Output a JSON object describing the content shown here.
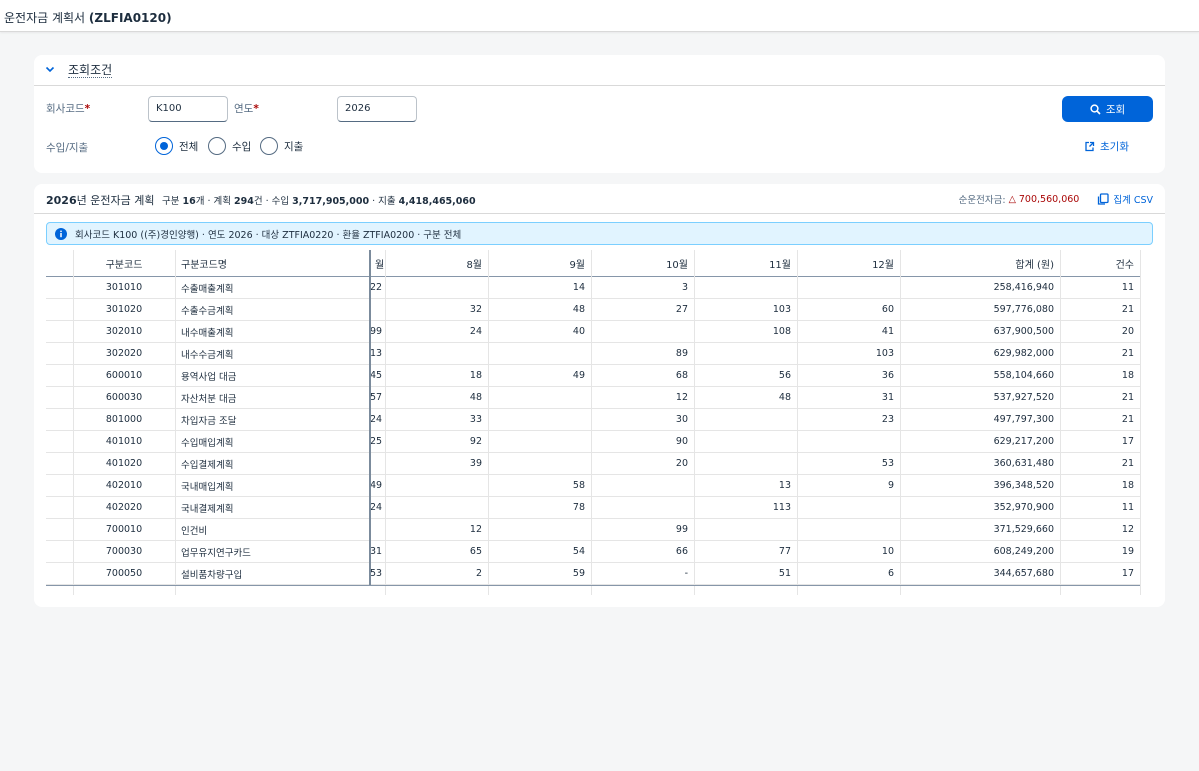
{
  "header": {
    "title_prefix": "운전자금 계획서 ",
    "title_code": "(ZLFIA0120)"
  },
  "filter": {
    "title": "조회조건",
    "company_label": "회사코드",
    "company_value": "K100",
    "year_label": "연도",
    "year_value": "2026",
    "required_mark": "*",
    "io_label": "수입/지출",
    "radio_all": "전체",
    "radio_in": "수입",
    "radio_out": "지출",
    "selected_radio": "전체",
    "go_label": "조회",
    "reset_label": "초기화"
  },
  "summary": {
    "year": "2026",
    "title_rest": "년 운전자금 계획",
    "part1": "구분 ",
    "group_count": "16",
    "part2": "개 · 계획 ",
    "plan_count": "294",
    "part3": "건 · 수입 ",
    "income": "3,717,905,000",
    "part4": " · 지출 ",
    "expense": "4,418,465,060",
    "net_label": "순운전자금:",
    "net_value": "△ 700,560,060",
    "csv_label": "집계 CSV"
  },
  "info": {
    "text": "회사코드 K100 ((주)경인양행) · 연도 2026 · 대상 ZTFIA0220 · 환율 ZTFIA0200 · 구분 전체"
  },
  "table": {
    "columns": [
      "구분코드",
      "구분코드명",
      "월",
      "8월",
      "9월",
      "10월",
      "11월",
      "12월",
      "합계 (원)",
      "건수"
    ],
    "rows": [
      {
        "code": "301010",
        "name": "수출매출계획",
        "m7": "22",
        "m8": "",
        "m9": "14",
        "m10": "3",
        "m11": "",
        "m12": "",
        "total": "258,416,940",
        "count": "11"
      },
      {
        "code": "301020",
        "name": "수출수금계획",
        "m7": "",
        "m8": "32",
        "m9": "48",
        "m10": "27",
        "m11": "103",
        "m12": "60",
        "total": "597,776,080",
        "count": "21"
      },
      {
        "code": "302010",
        "name": "내수매출계획",
        "m7": "99",
        "m8": "24",
        "m9": "40",
        "m10": "",
        "m11": "108",
        "m12": "41",
        "total": "637,900,500",
        "count": "20"
      },
      {
        "code": "302020",
        "name": "내수수금계획",
        "m7": "13",
        "m8": "",
        "m9": "",
        "m10": "89",
        "m11": "",
        "m12": "103",
        "total": "629,982,000",
        "count": "21"
      },
      {
        "code": "600010",
        "name": "용역사업 대금",
        "m7": "45",
        "m8": "18",
        "m9": "49",
        "m10": "68",
        "m11": "56",
        "m12": "36",
        "total": "558,104,660",
        "count": "18"
      },
      {
        "code": "600030",
        "name": "자산처분 대금",
        "m7": "57",
        "m8": "48",
        "m9": "",
        "m10": "12",
        "m11": "48",
        "m12": "31",
        "total": "537,927,520",
        "count": "21"
      },
      {
        "code": "801000",
        "name": "차입자금 조달",
        "m7": "24",
        "m8": "33",
        "m9": "",
        "m10": "30",
        "m11": "",
        "m12": "23",
        "total": "497,797,300",
        "count": "21"
      },
      {
        "code": "401010",
        "name": "수입매입계획",
        "m7": "25",
        "m8": "92",
        "m9": "",
        "m10": "90",
        "m11": "",
        "m12": "",
        "total": "629,217,200",
        "count": "17"
      },
      {
        "code": "401020",
        "name": "수입결제계획",
        "m7": "",
        "m8": "39",
        "m9": "",
        "m10": "20",
        "m11": "",
        "m12": "53",
        "total": "360,631,480",
        "count": "21"
      },
      {
        "code": "402010",
        "name": "국내매입계획",
        "m7": "49",
        "m8": "",
        "m9": "58",
        "m10": "",
        "m11": "13",
        "m12": "9",
        "total": "396,348,520",
        "count": "18"
      },
      {
        "code": "402020",
        "name": "국내결제계획",
        "m7": "24",
        "m8": "",
        "m9": "78",
        "m10": "",
        "m11": "113",
        "m12": "",
        "total": "352,970,900",
        "count": "11"
      },
      {
        "code": "700010",
        "name": "인건비",
        "m7": "",
        "m8": "12",
        "m9": "",
        "m10": "99",
        "m11": "",
        "m12": "",
        "total": "371,529,660",
        "count": "12"
      },
      {
        "code": "700030",
        "name": "업무유지연구카드",
        "m7": "31",
        "m8": "65",
        "m9": "54",
        "m10": "66",
        "m11": "77",
        "m12": "10",
        "total": "608,249,200",
        "count": "19"
      },
      {
        "code": "700050",
        "name": "설비품차량구입",
        "m7": "53",
        "m8": "2",
        "m9": "59",
        "m10": "-",
        "m11": "51",
        "m12": "6",
        "total": "344,657,680",
        "count": "17"
      }
    ]
  },
  "colors": {
    "accent": "#0064d9",
    "negative": "#aa0808",
    "info_bg": "#e1f4ff"
  },
  "icons": [
    "chevron-down-icon",
    "search-icon",
    "reset-icon",
    "info-icon",
    "copy-icon"
  ]
}
